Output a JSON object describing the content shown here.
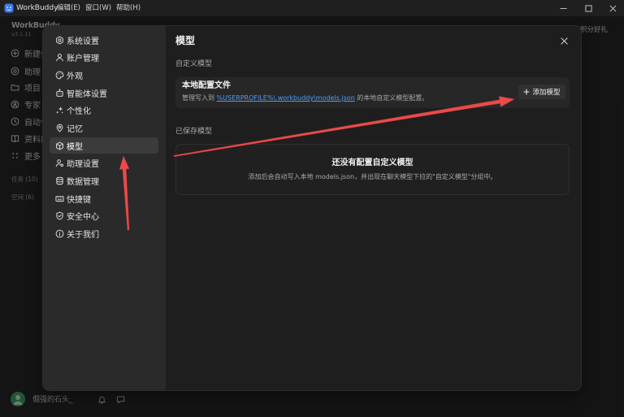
{
  "titlebar": {
    "app_name": "WorkBuddy",
    "logo_icon": "workbuddy-logo-icon",
    "menus": [
      "编辑(E)",
      "窗口(W)",
      "帮助(H)"
    ],
    "window_controls": [
      "minimize-icon",
      "maximize-icon",
      "close-icon"
    ]
  },
  "app_sidebar": {
    "brand": "WorkBuddy",
    "version": "v3.1.11",
    "items": [
      {
        "label": "新建任",
        "icon": "plus-circle-icon"
      },
      {
        "label": "助理",
        "icon": "assistant-icon"
      },
      {
        "label": "项目",
        "icon": "folder-icon"
      },
      {
        "label": "专家",
        "icon": "expert-icon"
      },
      {
        "label": "自动化",
        "icon": "clock-icon"
      },
      {
        "label": "资料库",
        "icon": "book-icon"
      },
      {
        "label": "更多",
        "icon": "more-icon"
      }
    ],
    "groups": [
      {
        "label": "任务 (10)"
      },
      {
        "label": "空间 (6)"
      }
    ],
    "user": {
      "name": "倔强的石头_",
      "icons": [
        "bell-icon",
        "chat-icon"
      ]
    }
  },
  "header_right": {
    "points_label": "积分好礼"
  },
  "settings": {
    "nav": [
      {
        "label": "系统设置",
        "icon": "gear-icon"
      },
      {
        "label": "账户管理",
        "icon": "person-icon"
      },
      {
        "label": "外观",
        "icon": "palette-icon"
      },
      {
        "label": "智能体设置",
        "icon": "robot-icon"
      },
      {
        "label": "个性化",
        "icon": "sparkle-icon"
      },
      {
        "label": "记忆",
        "icon": "pin-icon"
      },
      {
        "label": "模型",
        "icon": "cube-icon",
        "selected": true
      },
      {
        "label": "助理设置",
        "icon": "user-gear-icon"
      },
      {
        "label": "数据管理",
        "icon": "database-icon"
      },
      {
        "label": "快捷键",
        "icon": "keyboard-icon"
      },
      {
        "label": "安全中心",
        "icon": "shield-icon"
      },
      {
        "label": "关于我们",
        "icon": "info-icon"
      }
    ],
    "title": "模型",
    "close_icon": "close-icon",
    "custom_section": {
      "label": "自定义模型",
      "config_card": {
        "title": "本地配置文件",
        "desc_prefix": "管理写入到 ",
        "path_link": "%USERPROFILE%\\.workbuddy\\models.json",
        "desc_suffix": " 的本地自定义模型配置。",
        "add_button_label": "添加模型",
        "add_button_icon": "plus-icon"
      }
    },
    "saved_section": {
      "label": "已保存模型",
      "empty_title": "还没有配置自定义模型",
      "empty_desc": "添加后会自动写入本地 models.json，并出现在聊天模型下拉的\"自定义模型\"分组中。"
    }
  },
  "colors": {
    "link": "#4c9dff",
    "arrow": "#e94b4b",
    "nav_selected": "#3b3b3b",
    "avatar": "#3f9c64"
  }
}
